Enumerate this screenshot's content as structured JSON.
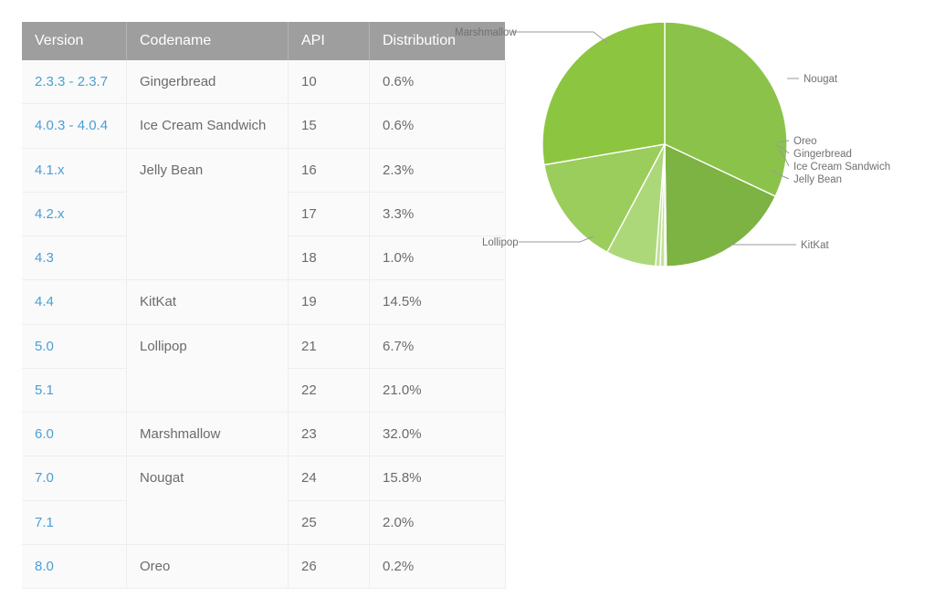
{
  "table": {
    "name": "android-platform-version-distribution",
    "columns": [
      "Version",
      "Codename",
      "API",
      "Distribution"
    ],
    "rows": [
      {
        "version": "2.3.3 - 2.3.7",
        "codename": "Gingerbread",
        "api": "10",
        "distribution": "0.6%"
      },
      {
        "version": "4.0.3 - 4.0.4",
        "codename": "Ice Cream Sandwich",
        "api": "15",
        "distribution": "0.6%"
      },
      {
        "version": "4.1.x",
        "codename": "Jelly Bean",
        "api": "16",
        "distribution": "2.3%"
      },
      {
        "version": "4.2.x",
        "codename": "",
        "api": "17",
        "distribution": "3.3%"
      },
      {
        "version": "4.3",
        "codename": "",
        "api": "18",
        "distribution": "1.0%"
      },
      {
        "version": "4.4",
        "codename": "KitKat",
        "api": "19",
        "distribution": "14.5%"
      },
      {
        "version": "5.0",
        "codename": "Lollipop",
        "api": "21",
        "distribution": "6.7%"
      },
      {
        "version": "5.1",
        "codename": "",
        "api": "22",
        "distribution": "21.0%"
      },
      {
        "version": "6.0",
        "codename": "Marshmallow",
        "api": "23",
        "distribution": "32.0%"
      },
      {
        "version": "7.0",
        "codename": "Nougat",
        "api": "24",
        "distribution": "15.8%"
      },
      {
        "version": "7.1",
        "codename": "",
        "api": "25",
        "distribution": "2.0%"
      },
      {
        "version": "8.0",
        "codename": "Oreo",
        "api": "26",
        "distribution": "0.2%"
      }
    ],
    "header_bg": "#9e9e9e",
    "link_color": "#4a9fd5",
    "text_color": "#6b6b6b"
  },
  "chart_data": {
    "type": "pie",
    "title": "",
    "legend_position": "callout-labels",
    "unit": "%",
    "categories": [
      "Marshmallow",
      "Nougat",
      "Oreo",
      "Gingerbread",
      "Ice Cream Sandwich",
      "Jelly Bean",
      "KitKat",
      "Lollipop"
    ],
    "values": [
      32.0,
      17.8,
      0.2,
      0.6,
      0.6,
      6.6,
      14.5,
      27.7
    ],
    "slices": [
      {
        "label": "Marshmallow",
        "value": 32.0,
        "color": "#8bc34a"
      },
      {
        "label": "Nougat",
        "value": 17.8,
        "color": "#7cb342"
      },
      {
        "label": "Oreo",
        "value": 0.2,
        "color": "#cde8a6"
      },
      {
        "label": "Gingerbread",
        "value": 0.6,
        "color": "#c5e39a"
      },
      {
        "label": "Ice Cream Sandwich",
        "value": 0.6,
        "color": "#bee092"
      },
      {
        "label": "Jelly Bean",
        "value": 6.6,
        "color": "#add87a"
      },
      {
        "label": "KitKat",
        "value": 14.5,
        "color": "#9acd5b"
      },
      {
        "label": "Lollipop",
        "value": 27.7,
        "color": "#8cc53f"
      }
    ],
    "labels": {
      "marshmallow": "Marshmallow",
      "nougat": "Nougat",
      "oreo": "Oreo",
      "gingerbread": "Gingerbread",
      "ice_cream_sandwich": "Ice Cream Sandwich",
      "jelly_bean": "Jelly Bean",
      "kitkat": "KitKat",
      "lollipop": "Lollipop"
    }
  }
}
